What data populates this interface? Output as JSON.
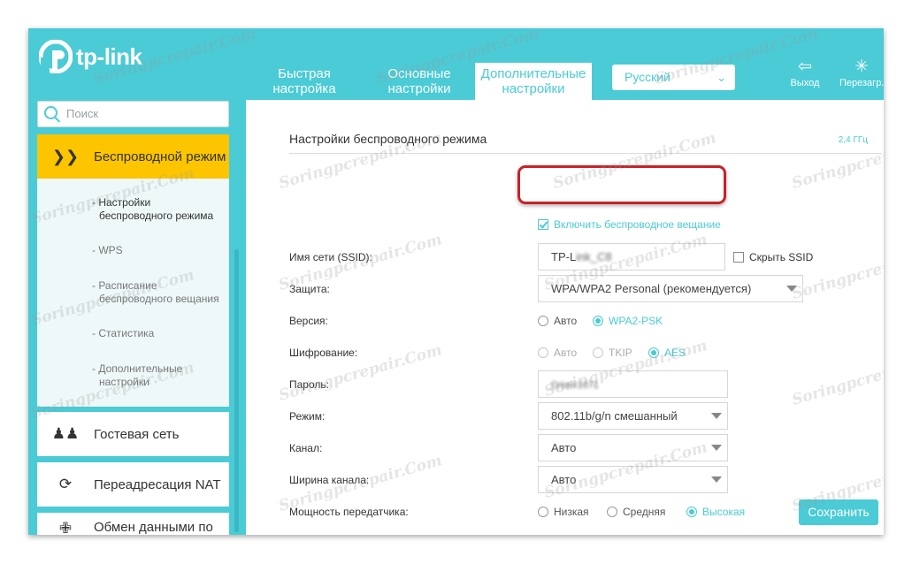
{
  "header": {
    "brand": "tp-link",
    "tabs": [
      {
        "line1": "Быстрая",
        "line2": "настройка"
      },
      {
        "line1": "Основные",
        "line2": "настройки"
      },
      {
        "line1": "Дополнительные",
        "line2": "настройки"
      }
    ],
    "language": "Русский",
    "logout_label": "Выход",
    "reboot_label": "Перезагр."
  },
  "sidebar": {
    "search_placeholder": "Поиск",
    "active_section": "Беспроводной режим",
    "subitems": [
      {
        "line1": "- Настройки",
        "line2": "беспроводного режима"
      },
      {
        "line1": "- WPS",
        "line2": ""
      },
      {
        "line1": "- Расписание",
        "line2": "беспроводного вещания"
      },
      {
        "line1": "- Статистика",
        "line2": ""
      },
      {
        "line1": "- Дополнительные",
        "line2": "настройки"
      }
    ],
    "items": [
      "Гостевая сеть",
      "Переадресация NAT",
      "Обмен данными по"
    ]
  },
  "main": {
    "title": "Настройки беспроводного режима",
    "band": "2,4 ГГц",
    "enable_broadcast": "Включить беспроводное вещание",
    "ssid_label": "Имя сети (SSID):",
    "ssid_value_visible": "TP-L",
    "ssid_value_blurred": "ink_C8",
    "hide_ssid": "Скрыть SSID",
    "security_label": "Защита:",
    "security_value": "WPA/WPA2 Personal (рекомендуется)",
    "version_label": "Версия:",
    "version_options": [
      "Авто",
      "WPA2-PSK"
    ],
    "encryption_label": "Шифрование:",
    "encryption_options": [
      "Авто",
      "TKIP",
      "AES"
    ],
    "password_label": "Пароль:",
    "password_value": "Driver1671",
    "mode_label": "Режим:",
    "mode_value": "802.11b/g/n смешанный",
    "channel_label": "Канал:",
    "channel_value": "Авто",
    "width_label": "Ширина канала:",
    "width_value": "Авто",
    "power_label": "Мощность передатчика:",
    "power_options": [
      "Низкая",
      "Средняя",
      "Высокая"
    ],
    "save": "Сохранить"
  },
  "watermark": "Soringpcrepair.Com",
  "colors": {
    "accent": "#4acbd6",
    "active_nav": "#fcc500",
    "highlight": "#c92028"
  }
}
